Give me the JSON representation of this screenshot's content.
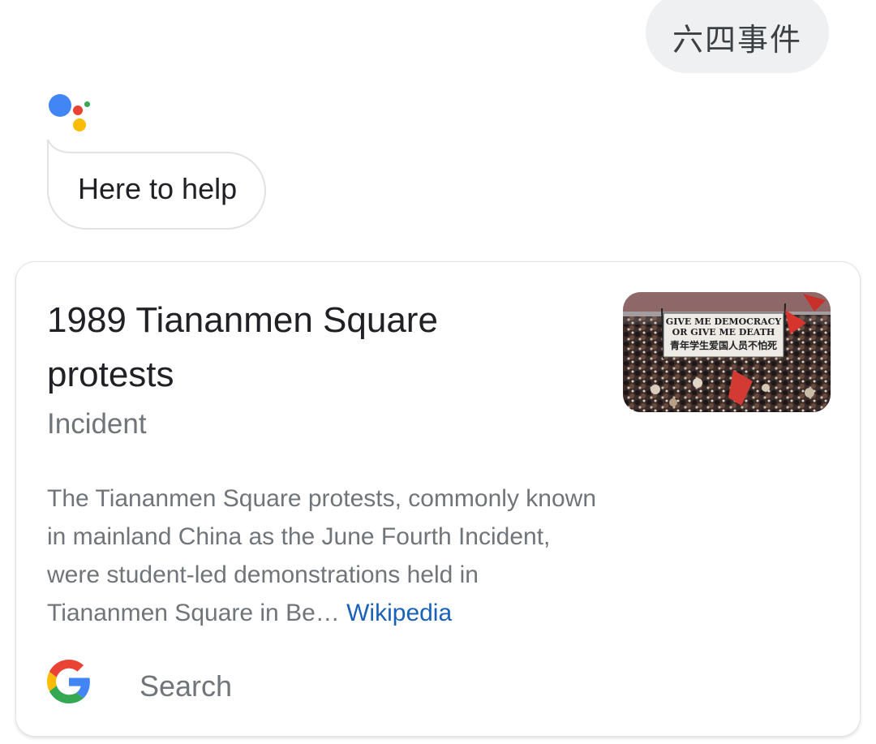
{
  "user_query": "六四事件",
  "assistant": {
    "reply": "Here to help"
  },
  "card": {
    "title": "1989 Tiananmen Square protests",
    "subtitle": "Incident",
    "description": "The Tiananmen Square protests, commonly known in mainland China as the June Fourth Incident, were student-led demonstrations held in Tiananmen Square in Be…",
    "source": "Wikipedia",
    "image": {
      "banner_text_line1": "GIVE ME DEMOCRACY",
      "banner_text_line2": "OR GIVE ME DEATH",
      "banner_text_line3": "青年学生爱国人员不怕死"
    },
    "footer": {
      "search_label": "Search"
    }
  },
  "colors": {
    "user_bubble_bg": "#eef0f2",
    "link": "#1a62b8",
    "google_blue": "#4285f4",
    "google_red": "#ea4335",
    "google_yellow": "#fbbc05",
    "google_green": "#34a853"
  }
}
